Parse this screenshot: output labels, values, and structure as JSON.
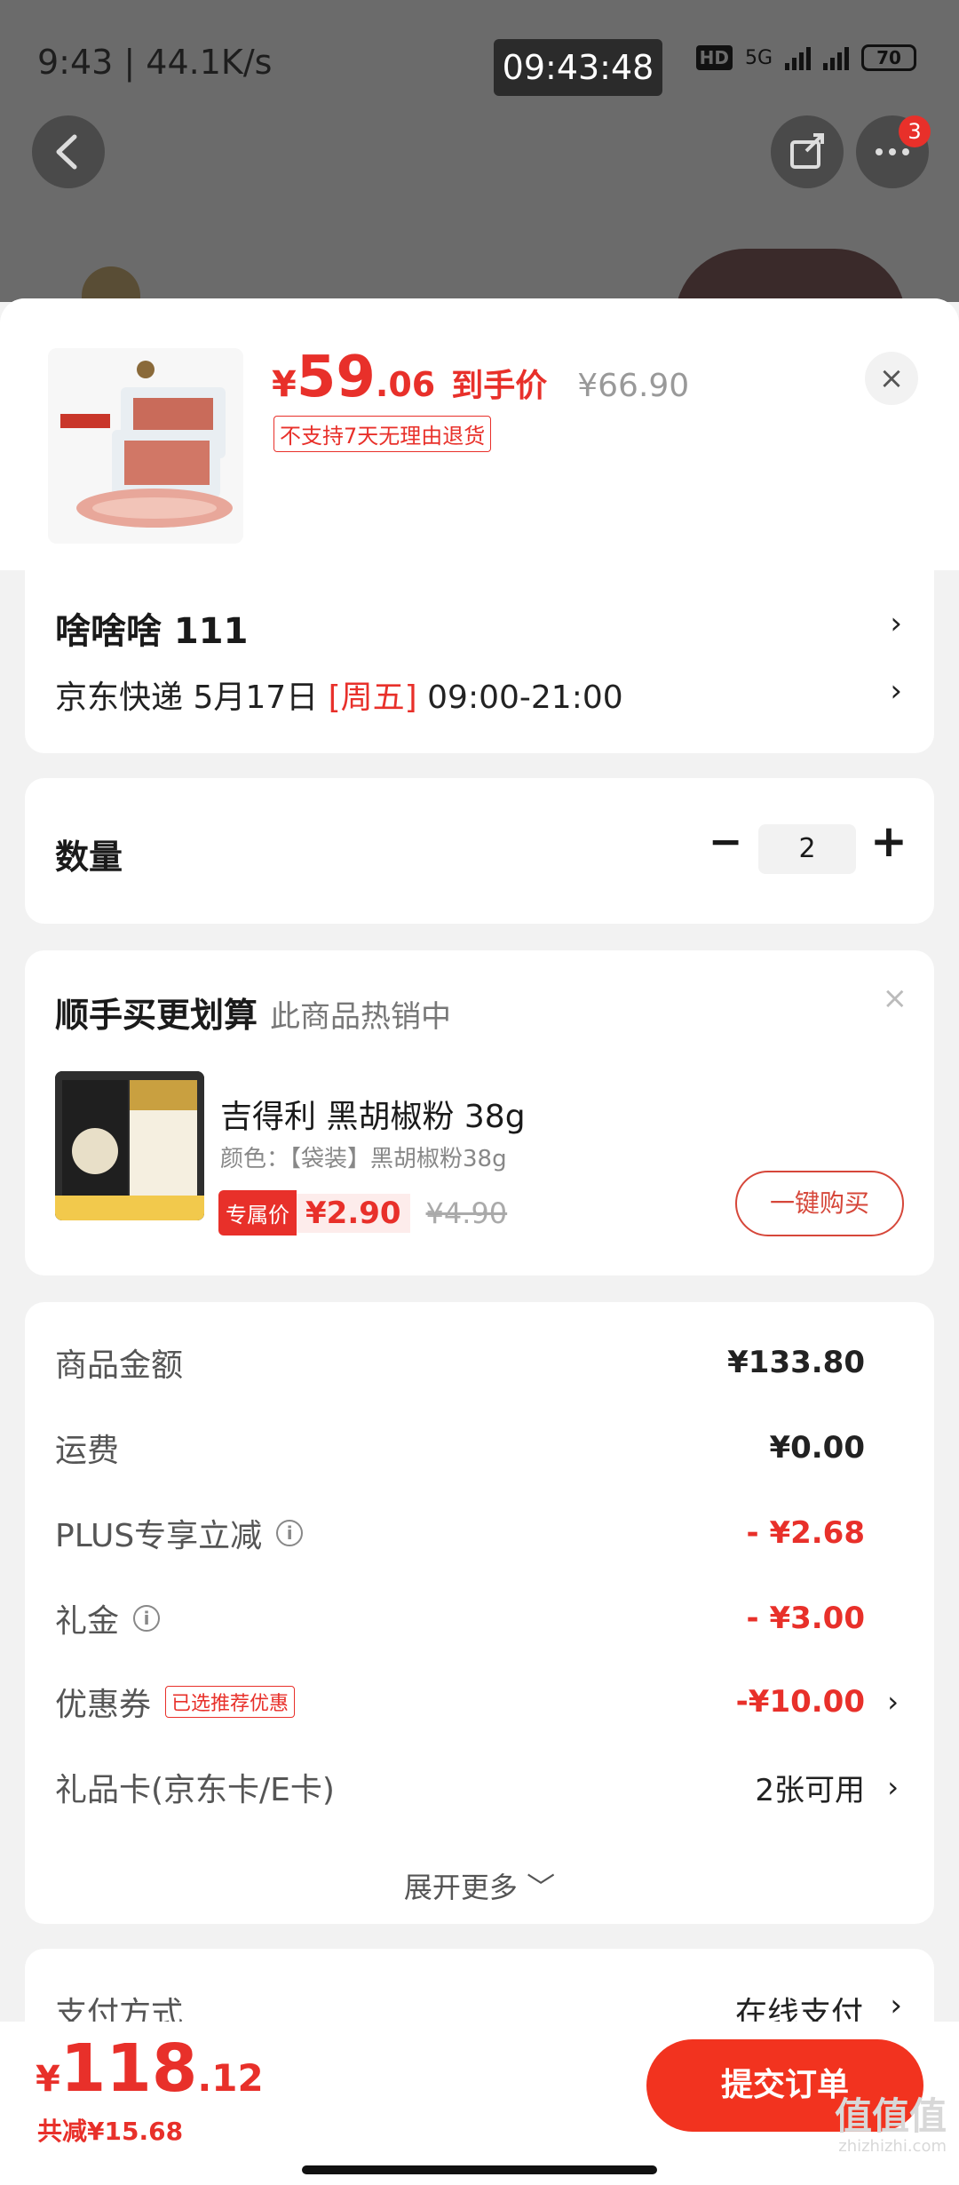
{
  "status_bar": {
    "time_speed": "9:43 | 44.1K/s",
    "clock": "09:43:48",
    "network": "5G",
    "battery": "70"
  },
  "top_nav": {
    "badge_count": "3"
  },
  "product": {
    "price_currency": "¥",
    "price_int": "59",
    "price_dec": ".06",
    "price_tag": "到手价",
    "price_original": "¥66.90",
    "no_return": "不支持7天无理由退货",
    "close": "×"
  },
  "address": {
    "name": "啥啥啥  111",
    "ship_prefix": "京东快递 5月17日 ",
    "weekday": "[周五]",
    "ship_time": " 09:00-21:00"
  },
  "quantity": {
    "label": "数量",
    "minus": "−",
    "value": "2",
    "plus": "+"
  },
  "addon": {
    "title": "顺手买更划算",
    "subtitle": "此商品热销中",
    "close": "×",
    "name": "吉得利 黑胡椒粉 38g",
    "spec": "颜色：【袋装】黑胡椒粉38g",
    "exclusive": "专属价",
    "price": "¥2.90",
    "original": "¥4.90",
    "buy": "一键购买"
  },
  "summary": {
    "rows": [
      {
        "label": "商品金额",
        "value": "¥133.80"
      },
      {
        "label": "运费",
        "value": "¥0.00"
      },
      {
        "label": "PLUS专享立减",
        "value": "- ¥2.68"
      },
      {
        "label": "礼金",
        "value": "- ¥3.00"
      },
      {
        "label": "优惠券",
        "tag": "已选推荐优惠",
        "value": "-¥10.00"
      },
      {
        "label": "礼品卡(京东卡/E卡)",
        "value": "2张可用"
      }
    ],
    "expand": "展开更多 ﹀"
  },
  "payment": {
    "label": "支付方式",
    "value": "在线支付"
  },
  "footer": {
    "total_currency": "¥",
    "total_int": "118",
    "total_dec": ".12",
    "saved": "共减¥15.68",
    "submit": "提交订单",
    "watermark": "值值值",
    "watermark_url": "zhizhizhi.com"
  },
  "colors": {
    "accent": "#e8302a",
    "submit": "#f2331f"
  }
}
